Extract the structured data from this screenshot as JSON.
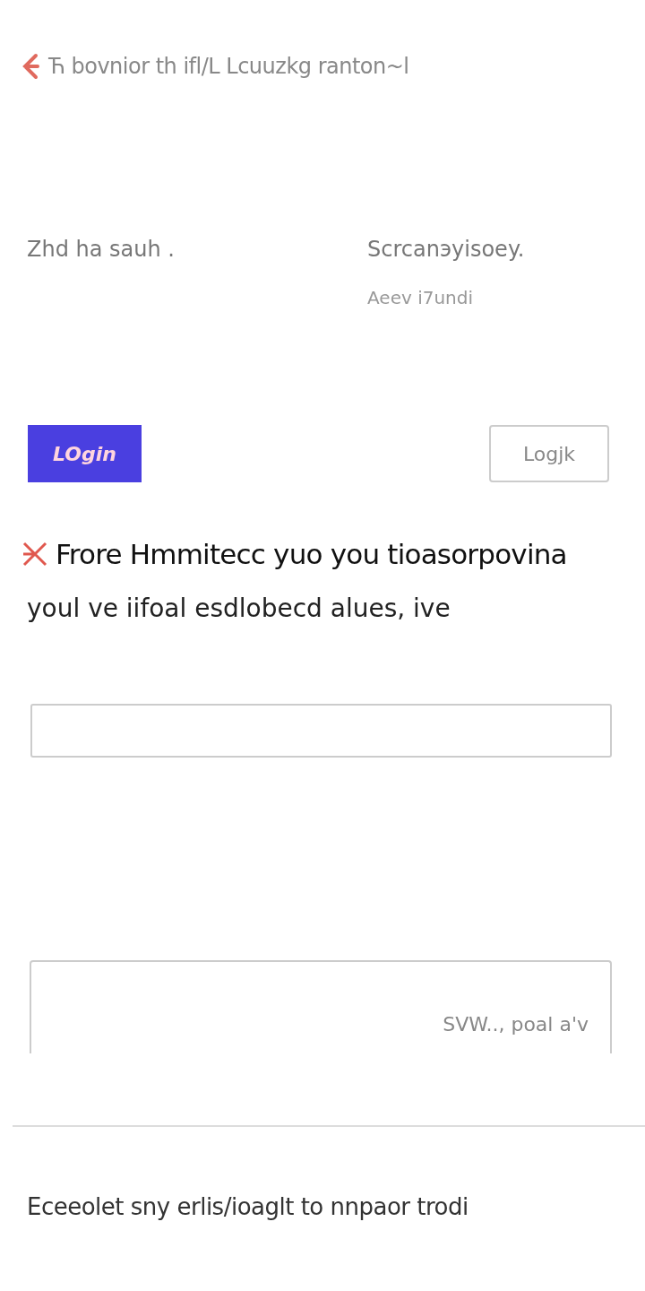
{
  "header": {
    "title": "Ћ bovnior th ifl/L Lcuuzkg ranton~l"
  },
  "columns": [
    {
      "lines": [
        "Zhd ha sauh ."
      ]
    },
    {
      "lines": [
        "Scrcanэyisoey.",
        "Aeev i7undi"
      ]
    }
  ],
  "buttons": [
    {
      "label": "LOgin",
      "kind": "primary"
    },
    {
      "label": "Logjk",
      "kind": "outline"
    }
  ],
  "error": {
    "title": "Frore Hmmitecc yuo you tioasorpovina",
    "message": "youl ve iifoal esdlobecd alues, ive"
  },
  "textarea": {
    "text": "SVW.., poal a'v"
  },
  "footer": {
    "text": "Eceeolet sny erlis/ioaglt to nnpaor trodi"
  }
}
